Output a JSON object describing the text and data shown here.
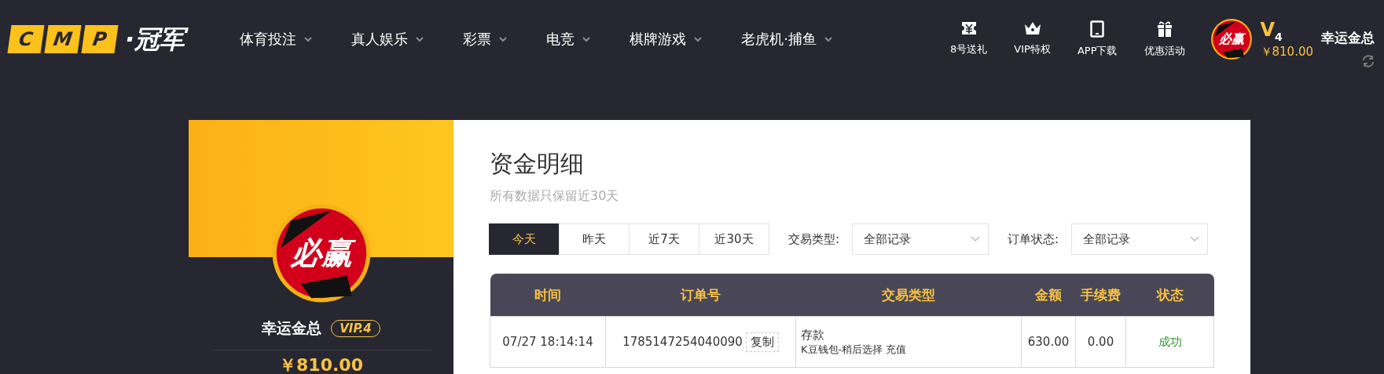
{
  "header": {
    "logo": {
      "letters": [
        "C",
        "M",
        "P"
      ],
      "text": "·冠军"
    },
    "nav": [
      {
        "label": "体育投注"
      },
      {
        "label": "真人娱乐"
      },
      {
        "label": "彩票"
      },
      {
        "label": "电竞"
      },
      {
        "label": "棋牌游戏"
      },
      {
        "label": "老虎机·捕鱼"
      }
    ],
    "quick_links": [
      {
        "kind": "ticket",
        "label": "8号送礼"
      },
      {
        "kind": "crown",
        "label": "VIP特权"
      },
      {
        "kind": "tablet",
        "label": "APP下载"
      },
      {
        "kind": "gift",
        "label": "优惠活动"
      }
    ],
    "user": {
      "avatar_text": "必赢",
      "vip": "V",
      "vip_level": "4",
      "balance": "￥810.00",
      "name": "幸运金总"
    }
  },
  "profile": {
    "avatar_text": "必赢",
    "name": "幸运金总",
    "vip_badge": "VIP.4",
    "balance": "￥810.00"
  },
  "main": {
    "title": "资金明细",
    "subtitle": "所有数据只保留近30天",
    "date_tabs": [
      {
        "label": "今天",
        "selected": true
      },
      {
        "label": "昨天",
        "selected": false
      },
      {
        "label": "近7天",
        "selected": false
      },
      {
        "label": "近30天",
        "selected": false
      }
    ],
    "filters": [
      {
        "label": "交易类型:",
        "value": "全部记录"
      },
      {
        "label": "订单状态:",
        "value": "全部记录"
      }
    ],
    "table": {
      "columns": [
        "时间",
        "订单号",
        "交易类型",
        "金额",
        "手续费",
        "状态"
      ],
      "rows": [
        {
          "time": "07/27 18:14:14",
          "order_no": "1785147254040090",
          "copy": "复制",
          "type": "存款",
          "type_detail": "K豆钱包-稍后选择 充值",
          "amount": "630.00",
          "fee": "0.00",
          "status": "成功"
        }
      ]
    }
  }
}
